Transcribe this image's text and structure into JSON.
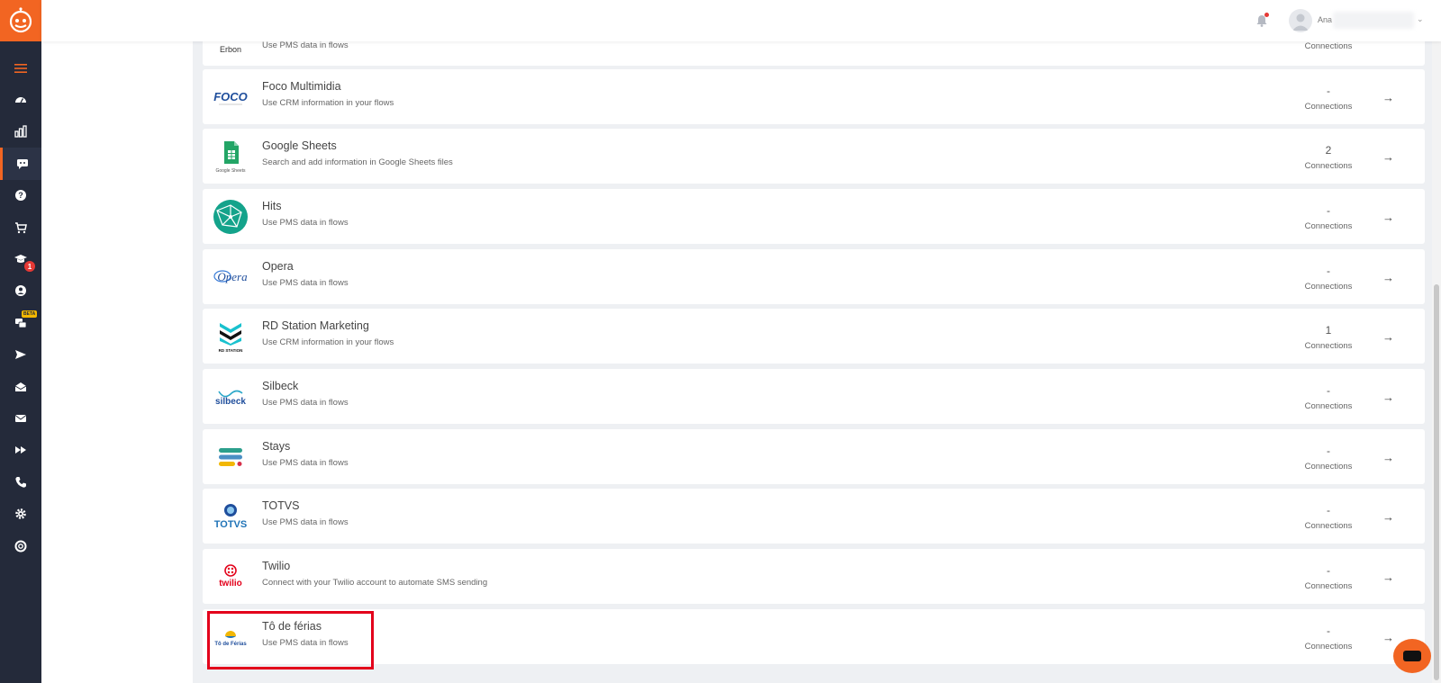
{
  "sidebar": {
    "badge_count": "1",
    "badge_beta": "BETA",
    "items": [
      "menu-icon",
      "dashboard-icon",
      "chart-icon",
      "chatbot-icon",
      "help-icon",
      "cart-icon",
      "graduation-icon",
      "user-icon",
      "chat-icon",
      "send-icon",
      "inbox-icon",
      "mail-icon",
      "forward-icon",
      "phone-icon",
      "settings-icon",
      "support-icon"
    ]
  },
  "topbar": {
    "user_name": "Ana"
  },
  "integrations": [
    {
      "title": "",
      "desc": "Use PMS data in flows",
      "count": "",
      "conn": "Connections",
      "logo": "Erbon"
    },
    {
      "title": "Foco Multimidia",
      "desc": "Use CRM information in your flows",
      "count": "-",
      "conn": "Connections",
      "logo": "FOCO"
    },
    {
      "title": "Google Sheets",
      "desc": "Search and add information in Google Sheets files",
      "count": "2",
      "conn": "Connections",
      "logo": "Google Sheets"
    },
    {
      "title": "Hits",
      "desc": "Use PMS data in flows",
      "count": "-",
      "conn": "Connections",
      "logo": ""
    },
    {
      "title": "Opera",
      "desc": "Use PMS data in flows",
      "count": "-",
      "conn": "Connections",
      "logo": "Opera"
    },
    {
      "title": "RD Station Marketing",
      "desc": "Use CRM information in your flows",
      "count": "1",
      "conn": "Connections",
      "logo": "RD STATION"
    },
    {
      "title": "Silbeck",
      "desc": "Use PMS data in flows",
      "count": "-",
      "conn": "Connections",
      "logo": "silbeck"
    },
    {
      "title": "Stays",
      "desc": "Use PMS data in flows",
      "count": "-",
      "conn": "Connections",
      "logo": ""
    },
    {
      "title": "TOTVS",
      "desc": "Use PMS data in flows",
      "count": "-",
      "conn": "Connections",
      "logo": "TOTVS"
    },
    {
      "title": "Twilio",
      "desc": "Connect with your Twilio account to automate SMS sending",
      "count": "-",
      "conn": "Connections",
      "logo": "twilio"
    },
    {
      "title": "Tô de férias",
      "desc": "Use PMS data in flows",
      "count": "-",
      "conn": "Connections",
      "logo": "Tô de Férias"
    }
  ],
  "arrow": "→"
}
